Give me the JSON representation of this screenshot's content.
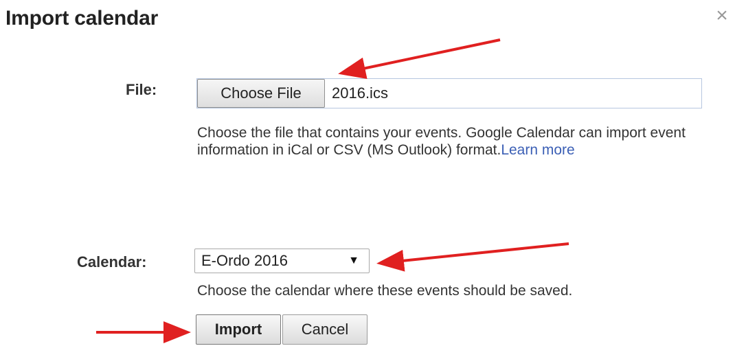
{
  "dialog": {
    "title": "Import calendar",
    "close_icon": "close-icon"
  },
  "file_section": {
    "label": "File:",
    "choose_button_label": "Choose File",
    "selected_file": "2016.ics",
    "help_text": "Choose the file that contains your events. Google Calendar can import event information in iCal or CSV (MS Outlook) format.",
    "learn_more_label": "Learn more"
  },
  "calendar_section": {
    "label": "Calendar:",
    "selected_calendar": "E-Ordo 2016",
    "dropdown_icon": "chevron-down-icon",
    "help_text": "Choose the calendar where these events should be saved."
  },
  "actions": {
    "import_label": "Import",
    "cancel_label": "Cancel"
  },
  "colors": {
    "annotation_arrow": "#e02020",
    "link": "#3b5fb5"
  }
}
